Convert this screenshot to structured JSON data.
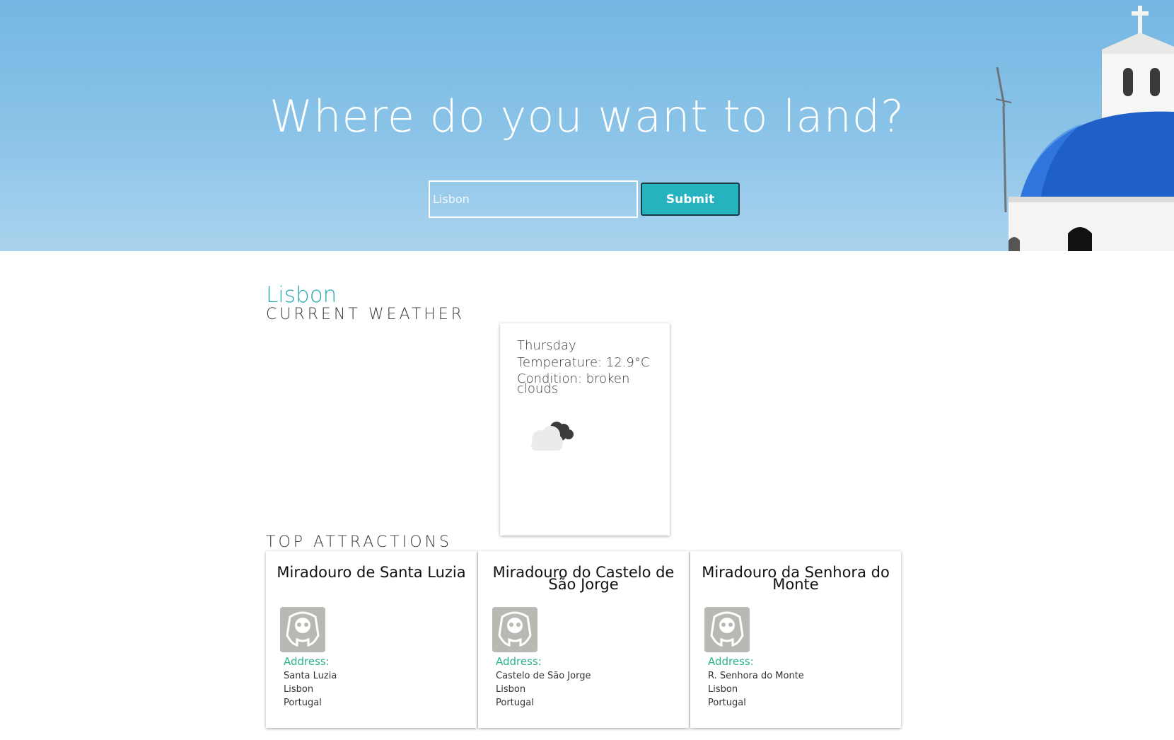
{
  "hero": {
    "title": "Where do you want to land?",
    "search_placeholder": "Lisbon",
    "submit_label": "Submit"
  },
  "city": {
    "name": "Lisbon"
  },
  "weather": {
    "heading": "CURRENT WEATHER",
    "day": "Thursday",
    "temperature": "Temperature: 12.9°C",
    "condition": "Condition: broken clouds",
    "icon": "broken-clouds-icon"
  },
  "attractions": {
    "heading": "TOP ATTRACTIONS",
    "address_label": "Address:",
    "items": [
      {
        "name": "Miradouro de Santa Luzia",
        "icon": "viewpoint-binoculars-icon",
        "address": [
          "Santa Luzia",
          "Lisbon",
          "Portugal"
        ]
      },
      {
        "name": "Miradouro do Castelo de São Jorge",
        "icon": "viewpoint-binoculars-icon",
        "address": [
          "Castelo de São Jorge",
          "Lisbon",
          "Portugal"
        ]
      },
      {
        "name": "Miradouro da Senhora do Monte",
        "icon": "viewpoint-binoculars-icon",
        "address": [
          "R. Senhora do Monte",
          "Lisbon",
          "Portugal"
        ]
      }
    ]
  },
  "colors": {
    "accent": "#2aaab5",
    "button": "#25b4bf",
    "address_label": "#2bb38f",
    "sky": "#7fbde6",
    "dome": "#1f5fc8"
  }
}
